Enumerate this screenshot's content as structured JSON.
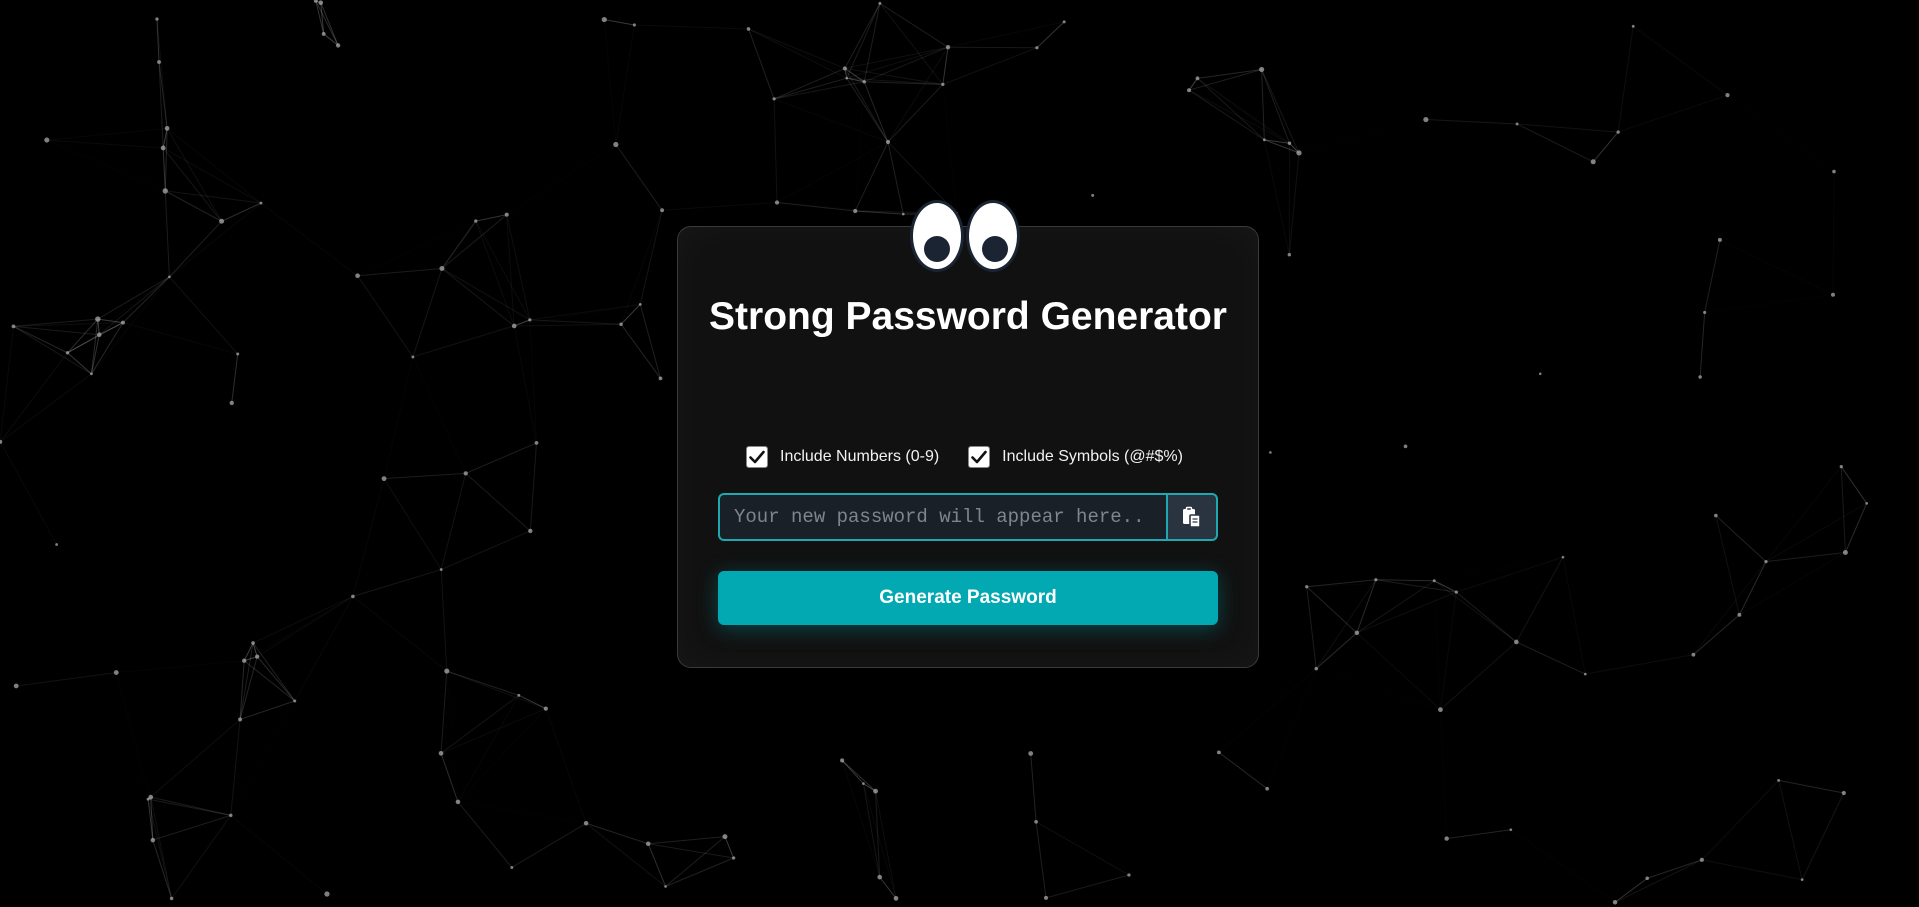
{
  "app": {
    "title": "Strong Password Generator"
  },
  "options": [
    {
      "label": "Include Numbers (0-9)",
      "checked": true
    },
    {
      "label": "Include Symbols (@#$%)",
      "checked": true
    }
  ],
  "password": {
    "value": "",
    "placeholder": "Your new password will appear here.."
  },
  "icons": {
    "copy": "clipboard-copy-icon",
    "eyes": "googly-eyes-icon"
  },
  "actions": {
    "generate_label": "Generate Password"
  },
  "colors": {
    "accent": "#02a9b3",
    "background": "#000000",
    "card": "#121212"
  }
}
